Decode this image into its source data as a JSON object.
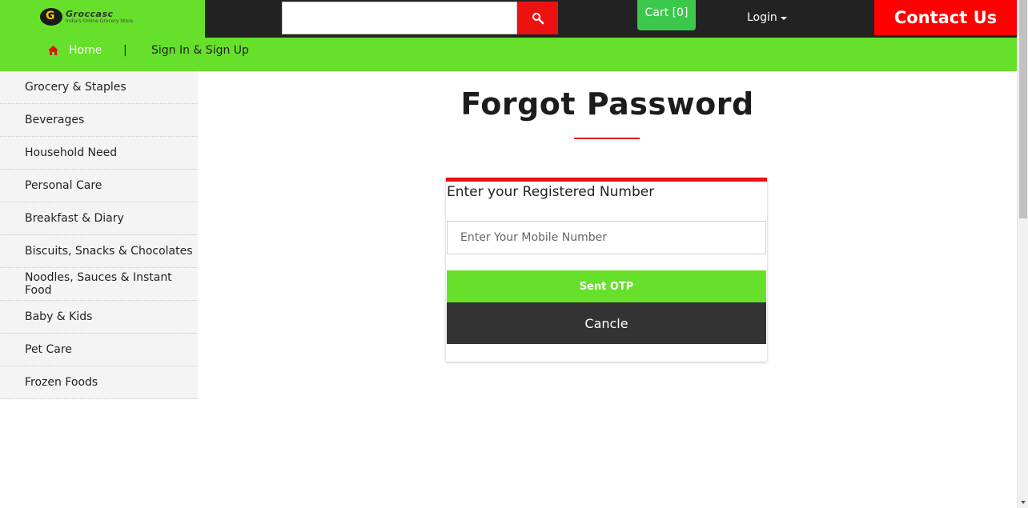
{
  "header": {
    "logo": {
      "name": "Groccasc",
      "tagline": "India's Online Grocery Store",
      "mark": "G"
    },
    "search": {
      "value": "",
      "placeholder": "",
      "button_icon": "search-icon"
    },
    "cart_label": "Cart [0]",
    "login_label": "Login",
    "contact_label": "Contact Us"
  },
  "nav": {
    "home_icon": "home-icon",
    "home_label": "Home",
    "separator": "|",
    "signin_label": "Sign In & Sign Up"
  },
  "sidebar": {
    "items": [
      {
        "label": "Grocery & Staples"
      },
      {
        "label": "Beverages"
      },
      {
        "label": "Household Need"
      },
      {
        "label": "Personal Care"
      },
      {
        "label": "Breakfast & Diary"
      },
      {
        "label": "Biscuits, Snacks & Chocolates"
      },
      {
        "label": "Noodles, Sauces & Instant Food"
      },
      {
        "label": "Baby & Kids"
      },
      {
        "label": "Pet Care"
      },
      {
        "label": "Frozen Foods"
      }
    ]
  },
  "main": {
    "title": "Forgot Password",
    "form": {
      "label": "Enter your Registered Number",
      "mobile": {
        "value": "",
        "placeholder": "Enter Your Mobile Number"
      },
      "submit_label": "Sent OTP",
      "cancel_label": "Cancle"
    }
  },
  "colors": {
    "brand_green": "#66e02a",
    "accent_red": "#ee1111",
    "dark": "#222222"
  }
}
